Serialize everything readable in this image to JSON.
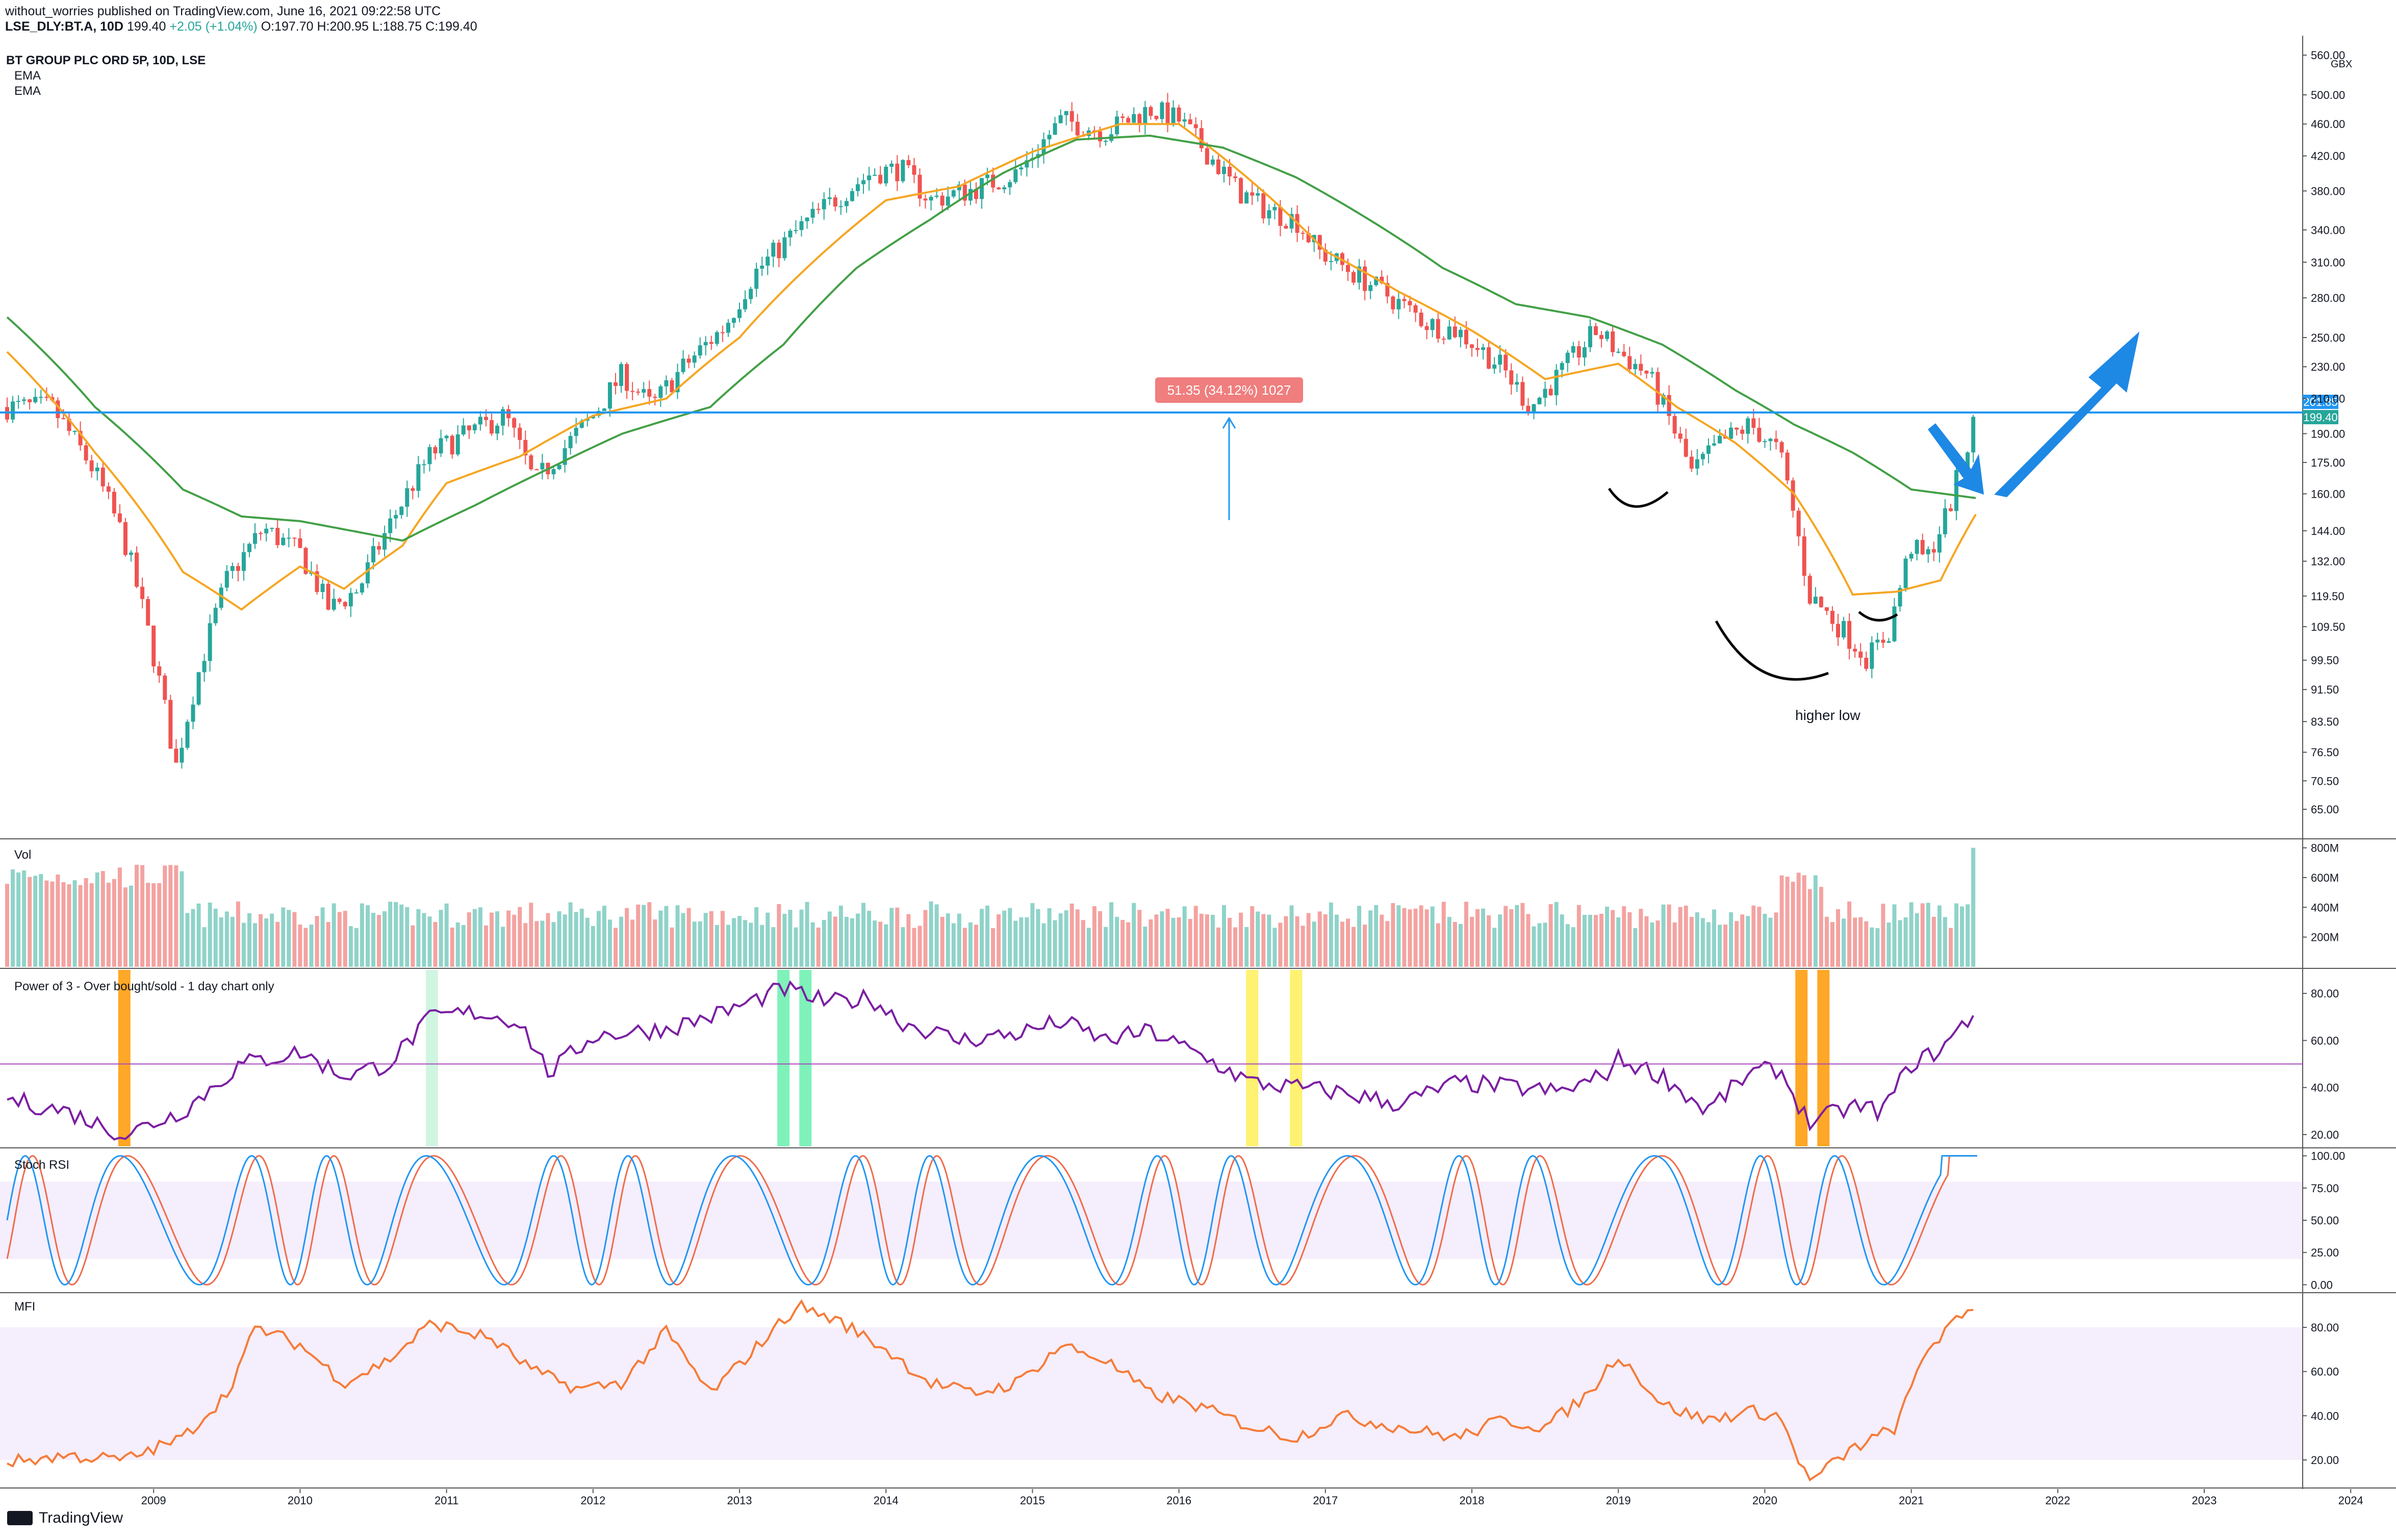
{
  "header": {
    "publisher_line": "without_worries published on TradingView.com, June 16, 2021 09:22:58 UTC",
    "symbol": "LSE_DLY:BT.A, 10D",
    "price": "199.40",
    "change": "+2.05 (+1.04%)",
    "ohlc": "O:197.70 H:200.95 L:188.75 C:199.40"
  },
  "legend": {
    "title": "BT GROUP PLC ORD 5P, 10D, LSE",
    "ema1": "EMA",
    "ema2": "EMA",
    "currency": "GBX"
  },
  "panes": {
    "vol": "Vol",
    "power": "Power of 3 - Over bought/sold - 1 day chart only",
    "stoch": "Stoch RSI",
    "mfi": "MFI"
  },
  "annotations": {
    "measure": "51.35 (34.12%) 1027",
    "higher_low": "higher low",
    "price_badge_upper": "201.85",
    "price_badge_lower": "199.40"
  },
  "brand": {
    "name": "TradingView"
  },
  "colors": {
    "up": "#26a69a",
    "down": "#ef5350",
    "ema_fast": "#f5a623",
    "ema_slow": "#43a047",
    "hline": "#2196f3",
    "power": "#7b1fa2",
    "stoch_k": "#2196f3",
    "stoch_d": "#ef6c4c",
    "mfi": "#f57c3a",
    "band": "#f5eefc",
    "arrow": "#1e88e5"
  },
  "chart_data": {
    "type": "candlestick",
    "x_ticks": [
      "2009",
      "2010",
      "2011",
      "2012",
      "2013",
      "2014",
      "2015",
      "2016",
      "2017",
      "2018",
      "2019",
      "2020",
      "2021",
      "2022",
      "2023",
      "2024"
    ],
    "price": {
      "scale": "log",
      "ticks": [
        "65.00",
        "70.50",
        "76.50",
        "83.50",
        "91.50",
        "99.50",
        "109.50",
        "119.50",
        "132.00",
        "144.00",
        "160.00",
        "175.00",
        "190.00",
        "210.00",
        "230.00",
        "250.00",
        "280.00",
        "310.00",
        "340.00",
        "380.00",
        "420.00",
        "460.00",
        "500.00",
        "560.00"
      ],
      "ylim": [
        60,
        575
      ],
      "horizontal_line": 201.85,
      "path_anchors": [
        [
          2008.3,
          205
        ],
        [
          2008.6,
          170
        ],
        [
          2008.8,
          140
        ],
        [
          2008.95,
          110
        ],
        [
          2009.15,
          73
        ],
        [
          2009.3,
          95
        ],
        [
          2009.5,
          125
        ],
        [
          2009.75,
          145
        ],
        [
          2010.0,
          135
        ],
        [
          2010.2,
          115
        ],
        [
          2010.4,
          122
        ],
        [
          2010.6,
          145
        ],
        [
          2010.9,
          180
        ],
        [
          2011.1,
          188
        ],
        [
          2011.4,
          200
        ],
        [
          2011.6,
          165
        ],
        [
          2011.8,
          182
        ],
        [
          2012.0,
          200
        ],
        [
          2012.2,
          225
        ],
        [
          2012.4,
          205
        ],
        [
          2012.6,
          228
        ],
        [
          2012.9,
          258
        ],
        [
          2013.1,
          300
        ],
        [
          2013.4,
          340
        ],
        [
          2013.6,
          365
        ],
        [
          2013.9,
          400
        ],
        [
          2014.1,
          405
        ],
        [
          2014.3,
          370
        ],
        [
          2014.6,
          382
        ],
        [
          2014.9,
          400
        ],
        [
          2015.2,
          465
        ],
        [
          2015.5,
          450
        ],
        [
          2015.8,
          480
        ],
        [
          2016.0,
          465
        ],
        [
          2016.4,
          380
        ],
        [
          2016.6,
          360
        ],
        [
          2016.8,
          350
        ],
        [
          2016.95,
          320
        ],
        [
          2017.2,
          300
        ],
        [
          2017.45,
          280
        ],
        [
          2017.7,
          260
        ],
        [
          2017.9,
          255
        ],
        [
          2018.2,
          230
        ],
        [
          2018.4,
          205
        ],
        [
          2018.6,
          225
        ],
        [
          2018.85,
          255
        ],
        [
          2019.0,
          240
        ],
        [
          2019.2,
          225
        ],
        [
          2019.5,
          170
        ],
        [
          2019.7,
          185
        ],
        [
          2019.9,
          195
        ],
        [
          2020.1,
          180
        ],
        [
          2020.3,
          120
        ],
        [
          2020.5,
          110
        ],
        [
          2020.7,
          100
        ],
        [
          2020.85,
          108
        ],
        [
          2021.0,
          138
        ],
        [
          2021.1,
          132
        ],
        [
          2021.25,
          152
        ],
        [
          2021.45,
          199.4
        ]
      ]
    },
    "series": [
      {
        "name": "EMA",
        "kind": "ema_fast",
        "anchors": [
          [
            2008.0,
            240
          ],
          [
            2008.6,
            180
          ],
          [
            2009.2,
            128
          ],
          [
            2009.6,
            115
          ],
          [
            2010.0,
            130
          ],
          [
            2010.3,
            122
          ],
          [
            2010.7,
            138
          ],
          [
            2011.0,
            165
          ],
          [
            2011.5,
            178
          ],
          [
            2012.0,
            200
          ],
          [
            2012.5,
            210
          ],
          [
            2013.0,
            250
          ],
          [
            2013.5,
            310
          ],
          [
            2014.0,
            370
          ],
          [
            2014.5,
            385
          ],
          [
            2015.0,
            425
          ],
          [
            2015.6,
            460
          ],
          [
            2016.0,
            460
          ],
          [
            2016.5,
            390
          ],
          [
            2017.0,
            320
          ],
          [
            2017.5,
            285
          ],
          [
            2018.0,
            255
          ],
          [
            2018.5,
            222
          ],
          [
            2019.0,
            232
          ],
          [
            2019.4,
            205
          ],
          [
            2019.8,
            185
          ],
          [
            2020.2,
            160
          ],
          [
            2020.6,
            120
          ],
          [
            2020.9,
            121
          ],
          [
            2021.2,
            125
          ],
          [
            2021.45,
            152
          ]
        ]
      },
      {
        "name": "EMA",
        "kind": "ema_slow",
        "anchors": [
          [
            2008.0,
            265
          ],
          [
            2008.6,
            205
          ],
          [
            2009.2,
            162
          ],
          [
            2009.6,
            150
          ],
          [
            2010.0,
            148
          ],
          [
            2010.7,
            140
          ],
          [
            2011.2,
            155
          ],
          [
            2011.7,
            172
          ],
          [
            2012.2,
            190
          ],
          [
            2012.8,
            205
          ],
          [
            2013.3,
            245
          ],
          [
            2013.8,
            305
          ],
          [
            2014.3,
            350
          ],
          [
            2014.8,
            400
          ],
          [
            2015.3,
            440
          ],
          [
            2015.8,
            445
          ],
          [
            2016.3,
            430
          ],
          [
            2016.8,
            395
          ],
          [
            2017.3,
            350
          ],
          [
            2017.8,
            305
          ],
          [
            2018.3,
            275
          ],
          [
            2018.8,
            265
          ],
          [
            2019.3,
            245
          ],
          [
            2019.8,
            215
          ],
          [
            2020.2,
            195
          ],
          [
            2020.6,
            180
          ],
          [
            2021.0,
            162
          ],
          [
            2021.45,
            158
          ]
        ]
      }
    ],
    "volume": {
      "ticks": [
        "800M",
        "600M",
        "400M",
        "200M"
      ],
      "ylim": [
        0,
        850
      ],
      "final_spike": 800
    },
    "power_of_3": {
      "ticks": [
        "80.00",
        "60.00",
        "40.00",
        "20.00"
      ],
      "ylim": [
        15,
        90
      ],
      "midline": 50,
      "anchors": [
        [
          2008.0,
          35
        ],
        [
          2008.4,
          30
        ],
        [
          2008.8,
          20
        ],
        [
          2009.2,
          30
        ],
        [
          2009.6,
          50
        ],
        [
          2010.0,
          55
        ],
        [
          2010.3,
          45
        ],
        [
          2010.6,
          50
        ],
        [
          2010.9,
          70
        ],
        [
          2011.2,
          72
        ],
        [
          2011.5,
          68
        ],
        [
          2011.7,
          46
        ],
        [
          2012.0,
          62
        ],
        [
          2012.5,
          65
        ],
        [
          2012.9,
          72
        ],
        [
          2013.3,
          82
        ],
        [
          2013.6,
          76
        ],
        [
          2013.9,
          78
        ],
        [
          2014.1,
          68
        ],
        [
          2014.5,
          60
        ],
        [
          2014.9,
          63
        ],
        [
          2015.2,
          68
        ],
        [
          2015.5,
          60
        ],
        [
          2015.8,
          64
        ],
        [
          2016.1,
          55
        ],
        [
          2016.5,
          42
        ],
        [
          2016.8,
          40
        ],
        [
          2017.1,
          38
        ],
        [
          2017.5,
          33
        ],
        [
          2017.9,
          42
        ],
        [
          2018.3,
          40
        ],
        [
          2018.6,
          38
        ],
        [
          2018.9,
          45
        ],
        [
          2019.0,
          52
        ],
        [
          2019.3,
          45
        ],
        [
          2019.6,
          30
        ],
        [
          2019.9,
          46
        ],
        [
          2020.1,
          48
        ],
        [
          2020.3,
          25
        ],
        [
          2020.6,
          32
        ],
        [
          2020.8,
          30
        ],
        [
          2021.0,
          50
        ],
        [
          2021.2,
          56
        ],
        [
          2021.45,
          73
        ]
      ],
      "highlights": [
        {
          "x": 2008.8,
          "color": "#ff9800"
        },
        {
          "x": 2010.9,
          "color": "#c8f5dc"
        },
        {
          "x": 2013.3,
          "color": "#69f0ae"
        },
        {
          "x": 2013.45,
          "color": "#69f0ae"
        },
        {
          "x": 2016.5,
          "color": "#ffee58"
        },
        {
          "x": 2016.8,
          "color": "#ffee58"
        },
        {
          "x": 2020.25,
          "color": "#ff9800"
        },
        {
          "x": 2020.4,
          "color": "#ff9800"
        }
      ]
    },
    "stoch_rsi": {
      "ticks": [
        "100.00",
        "75.00",
        "50.00",
        "25.00",
        "0.00"
      ],
      "ylim": [
        -5,
        105
      ],
      "band": [
        20,
        80
      ]
    },
    "mfi": {
      "ticks": [
        "80.00",
        "60.00",
        "40.00",
        "20.00"
      ],
      "ylim": [
        8,
        95
      ],
      "band": [
        20,
        80
      ],
      "anchors": [
        [
          2008.0,
          19
        ],
        [
          2008.4,
          22
        ],
        [
          2008.8,
          20
        ],
        [
          2009.2,
          30
        ],
        [
          2009.5,
          50
        ],
        [
          2009.7,
          80
        ],
        [
          2010.0,
          72
        ],
        [
          2010.3,
          55
        ],
        [
          2010.6,
          65
        ],
        [
          2010.9,
          82
        ],
        [
          2011.3,
          75
        ],
        [
          2011.6,
          60
        ],
        [
          2011.9,
          52
        ],
        [
          2012.2,
          55
        ],
        [
          2012.5,
          78
        ],
        [
          2012.8,
          50
        ],
        [
          2013.1,
          70
        ],
        [
          2013.4,
          90
        ],
        [
          2013.7,
          82
        ],
        [
          2014.0,
          70
        ],
        [
          2014.3,
          55
        ],
        [
          2014.6,
          50
        ],
        [
          2014.9,
          55
        ],
        [
          2015.2,
          72
        ],
        [
          2015.5,
          65
        ],
        [
          2015.8,
          50
        ],
        [
          2016.1,
          45
        ],
        [
          2016.5,
          35
        ],
        [
          2016.8,
          30
        ],
        [
          2017.1,
          40
        ],
        [
          2017.5,
          35
        ],
        [
          2017.9,
          30
        ],
        [
          2018.2,
          38
        ],
        [
          2018.5,
          35
        ],
        [
          2018.8,
          50
        ],
        [
          2019.0,
          68
        ],
        [
          2019.3,
          45
        ],
        [
          2019.6,
          38
        ],
        [
          2019.9,
          42
        ],
        [
          2020.1,
          40
        ],
        [
          2020.3,
          10
        ],
        [
          2020.6,
          25
        ],
        [
          2020.9,
          35
        ],
        [
          2021.1,
          70
        ],
        [
          2021.3,
          82
        ],
        [
          2021.45,
          91
        ]
      ]
    }
  }
}
